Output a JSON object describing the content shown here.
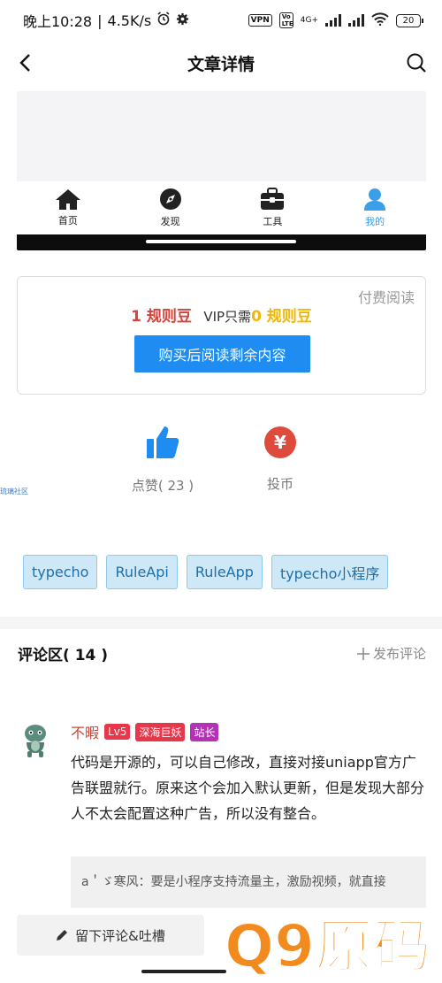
{
  "status_bar": {
    "time": "晚上10:28",
    "net_speed": "4.5K/s",
    "vpn": "VPN",
    "volte": "Vo LTE",
    "network": "4G+",
    "battery": "20"
  },
  "nav": {
    "title": "文章详情"
  },
  "embedded_app": {
    "tabs": [
      {
        "label": "首页",
        "icon": "home-icon"
      },
      {
        "label": "发现",
        "icon": "compass-icon"
      },
      {
        "label": "工具",
        "icon": "toolbox-icon"
      },
      {
        "label": "我的",
        "icon": "user-icon"
      }
    ],
    "active_color": "#3b9ee8"
  },
  "paywall": {
    "tag": "付费阅读",
    "price": "1 规则豆",
    "vip_prefix": "VIP只需",
    "vip_price": "0 规则豆",
    "button": "购买后阅读剩余内容"
  },
  "actions": {
    "like_label": "点赞( 23 )",
    "tip_label": "投币",
    "tip_symbol": "¥",
    "side_note": "琉璃社区"
  },
  "tags": [
    "typecho",
    "RuleApi",
    "RuleApp",
    "typecho小程序"
  ],
  "comments": {
    "title": "评论区( 14 )",
    "post_label": "发布评论",
    "items": [
      {
        "name": "不暇",
        "level": "Lv5",
        "title": "深海巨妖",
        "role": "站长",
        "text": "代码是开源的，可以自己修改，直接对接uniapp官方广告联盟就行。原来这个会加入默认更新，但是发现大部分人不太会配置这种广告，所以没有整合。",
        "reply": "a＇ゞ寒风：要是小程序支持流量主，激励视频，就直接"
      }
    ]
  },
  "bottom": {
    "comment_button": "留下评论&吐槽",
    "watermark_text": "Q9原码"
  },
  "colors": {
    "accent_blue": "#1e8cf0",
    "price_red": "#d9413a",
    "price_gold": "#f2b705",
    "watermark_orange": "#f28a1d"
  }
}
